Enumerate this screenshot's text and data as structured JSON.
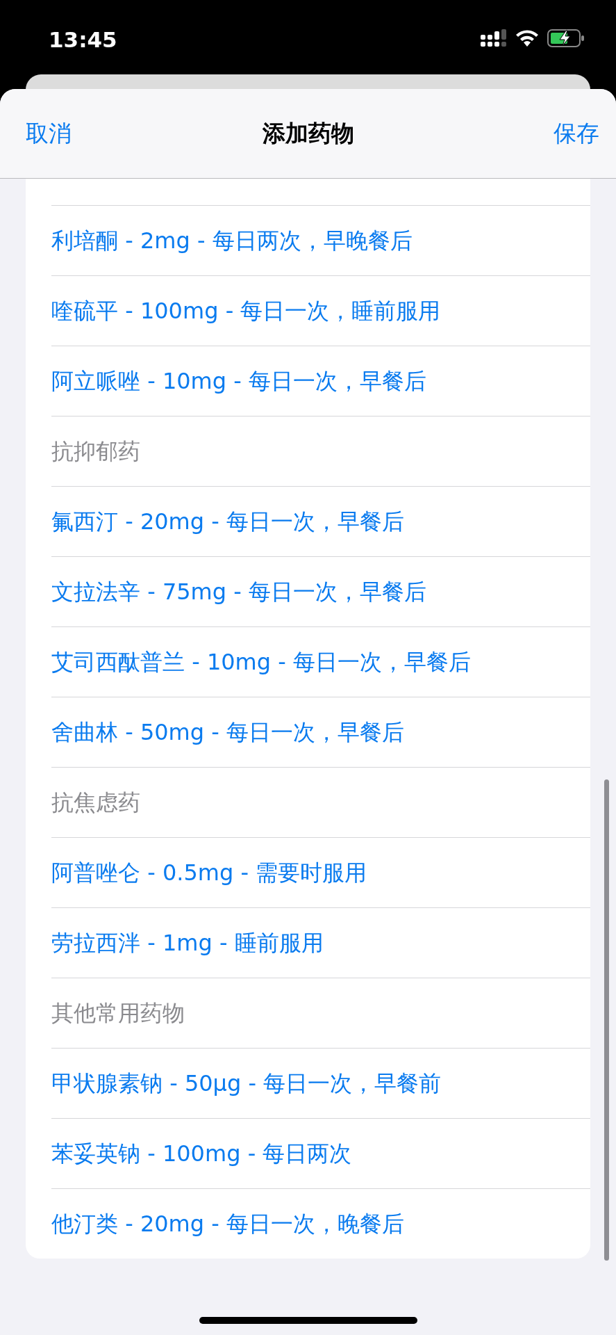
{
  "status_bar": {
    "time": "13:45"
  },
  "nav": {
    "cancel": "取消",
    "title": "添加药物",
    "save": "保存"
  },
  "sections": [
    {
      "items": [
        "利培酮 - 2mg - 每日两次，早晚餐后",
        "喹硫平 - 100mg - 每日一次，睡前服用",
        "阿立哌唑 - 10mg - 每日一次，早餐后"
      ]
    },
    {
      "header": "抗抑郁药",
      "items": [
        "氟西汀 - 20mg - 每日一次，早餐后",
        "文拉法辛 - 75mg - 每日一次，早餐后",
        "艾司西酞普兰 - 10mg - 每日一次，早餐后",
        "舍曲林 - 50mg - 每日一次，早餐后"
      ]
    },
    {
      "header": "抗焦虑药",
      "items": [
        "阿普唑仑 - 0.5mg - 需要时服用",
        "劳拉西泮 - 1mg - 睡前服用"
      ]
    },
    {
      "header": "其他常用药物",
      "items": [
        "甲状腺素钠 - 50μg - 每日一次，早餐前",
        "苯妥英钠 - 100mg - 每日两次",
        "他汀类 - 20mg - 每日一次，晚餐后"
      ]
    }
  ]
}
